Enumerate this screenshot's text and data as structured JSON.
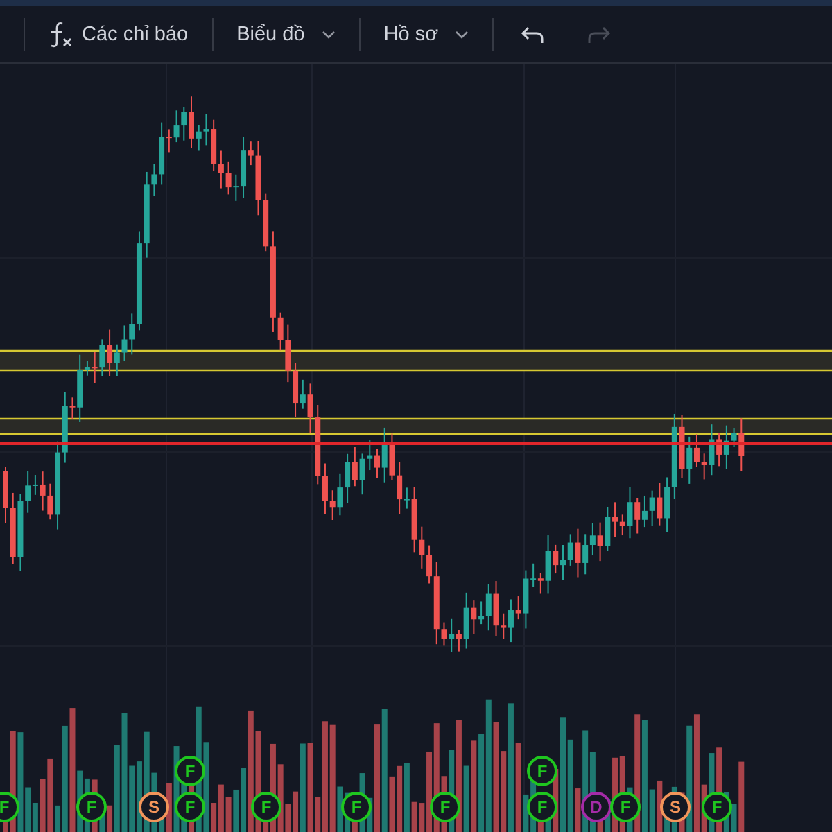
{
  "toolbar": {
    "items": [
      {
        "kind": "indicators",
        "label": "Các chỉ báo"
      },
      {
        "kind": "menu",
        "label": "Biểu đồ"
      },
      {
        "kind": "menu",
        "label": "Hồ sơ"
      }
    ],
    "undo": {
      "disabled": false
    },
    "redo": {
      "disabled": true
    }
  },
  "chart": {
    "events": [
      {
        "letter": "F",
        "color": "#1fc61f"
      },
      {
        "letter": "F",
        "color": "#1fc61f"
      },
      {
        "letter": "S",
        "color": "#f3955a"
      },
      {
        "letter": "F",
        "color": "#1fc61f"
      },
      {
        "letter": "F",
        "color": "#1fc61f"
      },
      {
        "letter": "F",
        "color": "#1fc61f"
      },
      {
        "letter": "F",
        "color": "#1fc61f"
      },
      {
        "letter": "F",
        "color": "#1fc61f"
      },
      {
        "letter": "F",
        "color": "#1fc61f"
      },
      {
        "letter": "F",
        "color": "#1fc61f"
      },
      {
        "letter": "D",
        "color": "#a52ba8"
      },
      {
        "letter": "F",
        "color": "#1fc61f"
      },
      {
        "letter": "S",
        "color": "#f3955a"
      },
      {
        "letter": "F",
        "color": "#1fc61f"
      }
    ]
  }
}
